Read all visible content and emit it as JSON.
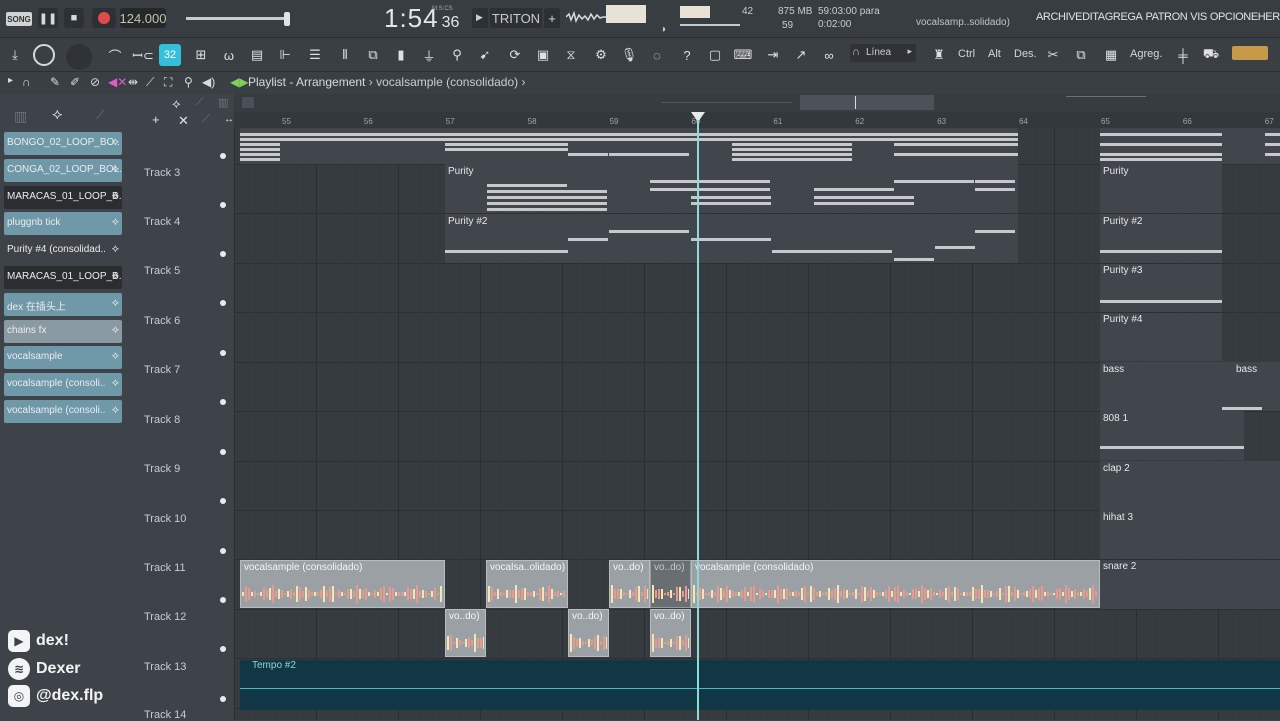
{
  "transport": {
    "mode": "SONG",
    "bpm": "124.000",
    "time_main": "1:54",
    "time_sub": "36",
    "time_unit": "M:S:CS",
    "pattern": "TRITON",
    "pattern_add": "+"
  },
  "status": {
    "cpu": "42",
    "memory": "875 MB",
    "polyphony": "59",
    "hint_line1": "59:03:00 para",
    "hint_line2": "0:02:00",
    "project": "vocalsamp..solidado)"
  },
  "menu": [
    "ARCHIV",
    "EDITA",
    "GREGA",
    "PATRON",
    "VIS",
    "OPCIONE",
    "HERRAMIEN"
  ],
  "toolbar": {
    "snap_label": "Línea",
    "ctrl": "Ctrl",
    "alt": "Alt",
    "des": "Des.",
    "agreg": "Agreg."
  },
  "playlist": {
    "title": "Playlist - Arrangement",
    "separator": "›",
    "arrangement": "vocalsample (consolidado)"
  },
  "browser": {
    "channels": [
      {
        "name": "BONGO_02_LOOP_BO..",
        "color": "#6f98a8"
      },
      {
        "name": "CONGA_02_LOOP_BOL..",
        "color": "#6f98a8"
      },
      {
        "name": "MARACAS_01_LOOP_B..",
        "color": "#2b2e31"
      },
      {
        "name": "pluggnb tick",
        "color": "#6f98a8"
      },
      {
        "name": "Purity #4 (consolidad..",
        "color": "#3d4348"
      },
      {
        "name": "MARACAS_01_LOOP_B..",
        "color": "#2b2e31"
      },
      {
        "name": "dex 在插头上",
        "color": "#6f98a8"
      },
      {
        "name": "chains fx",
        "color": "#8a9aa2"
      },
      {
        "name": "vocalsample",
        "color": "#6f98a8"
      },
      {
        "name": "vocalsample (consoli..",
        "color": "#6f98a8"
      },
      {
        "name": "vocalsample (consoli..",
        "color": "#6f98a8"
      }
    ]
  },
  "ruler": {
    "bars": [
      "55",
      "56",
      "57",
      "58",
      "59",
      "60",
      "61",
      "62",
      "63",
      "64",
      "65",
      "66",
      "67"
    ]
  },
  "tracks": [
    "Track 3",
    "Track 4",
    "Track 5",
    "Track 6",
    "Track 7",
    "Track 8",
    "Track 9",
    "Track 10",
    "Track 11",
    "Track 12",
    "Track 13",
    "Track 14"
  ],
  "clips": {
    "purity": "Purity",
    "purity2": "Purity #2",
    "purity3": "Purity #3",
    "purity4": "Purity #4",
    "bass": "bass",
    "bass2": "bass",
    "b808": "808 1",
    "clap": "clap 2",
    "hihat": "hihat 3",
    "snare": "snare 2",
    "vocal_a": "vocalsample (consolidado)",
    "vocal_b": "vocalsa..olidado)",
    "vocal_c": "vo..do)",
    "vocal_d": "vo..do)",
    "vocal_e": "vocalsample (consolidado)",
    "v12_a": "vo..do)",
    "v12_b": "vo..do)",
    "v12_c": "vo..do)",
    "tempo": "Tempo #2"
  },
  "social": {
    "youtube": "dex!",
    "spotify": "Dexer",
    "instagram": "@dex.flp"
  }
}
